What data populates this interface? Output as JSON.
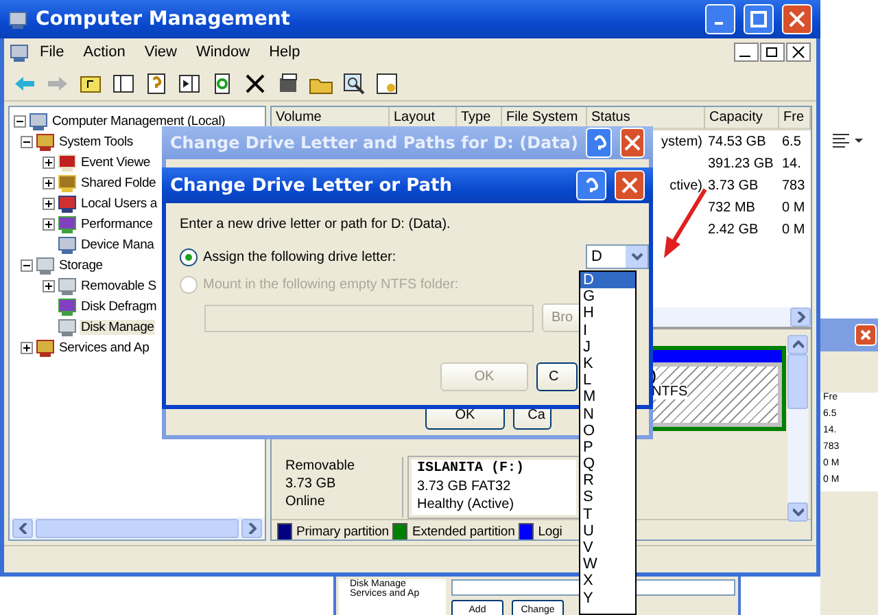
{
  "window": {
    "title": "Computer Management"
  },
  "menu": [
    "File",
    "Action",
    "View",
    "Window",
    "Help"
  ],
  "tree": [
    {
      "label": "Computer Management (Local)",
      "kind": "computer",
      "expanded": true,
      "selected": false,
      "children": [
        {
          "label": "System Tools",
          "kind": "tools",
          "expanded": true,
          "selected": false,
          "children": [
            {
              "label": "Event Viewe",
              "kind": "log",
              "expanded": false,
              "selected": false
            },
            {
              "label": "Shared Folde",
              "kind": "folder",
              "expanded": false,
              "selected": false
            },
            {
              "label": "Local Users a",
              "kind": "users",
              "expanded": false,
              "selected": false
            },
            {
              "label": "Performance",
              "kind": "chart",
              "expanded": false,
              "selected": false
            },
            {
              "label": "Device Mana",
              "kind": "computer",
              "selected": false
            }
          ]
        },
        {
          "label": "Storage",
          "kind": "drive",
          "expanded": true,
          "selected": false,
          "children": [
            {
              "label": "Removable S",
              "kind": "drive",
              "expanded": false,
              "selected": false
            },
            {
              "label": "Disk Defragm",
              "kind": "chart",
              "selected": false
            },
            {
              "label": "Disk Manage",
              "kind": "drive",
              "selected": true
            }
          ]
        },
        {
          "label": "Services and Ap",
          "kind": "tools",
          "expanded": false,
          "selected": false
        }
      ]
    }
  ],
  "volumes": {
    "columns": [
      "Volume",
      "Layout",
      "Type",
      "File System",
      "Status",
      "Capacity",
      "Fre"
    ],
    "rows": [
      {
        "status": "ystem)",
        "capacity": "74.53 GB",
        "free": "6.5"
      },
      {
        "status": "",
        "capacity": "391.23 GB",
        "free": "14."
      },
      {
        "status": "ctive)",
        "capacity": "3.73 GB",
        "free": "783"
      },
      {
        "status": "",
        "capacity": "732 MB",
        "free": "0 M"
      },
      {
        "status": "",
        "capacity": "2.42 GB",
        "free": "0 M"
      }
    ]
  },
  "disk_top": {
    "partition_lines": [
      ")",
      "NTFS"
    ]
  },
  "disk_bottom": {
    "info": [
      "Removable",
      "3.73 GB",
      "Online"
    ],
    "partition_name": "ISLANITA (F:)",
    "partition_lines": [
      "3.73 GB FAT32",
      "Healthy (Active)"
    ]
  },
  "legend": [
    {
      "label": "Primary partition",
      "color": "#000080"
    },
    {
      "label": "Extended partition",
      "color": "#008000"
    },
    {
      "label": "Logi",
      "color": "#0000ff"
    }
  ],
  "outer_dialog": {
    "title": "Change Drive Letter and Paths for D: (Data)",
    "active": false,
    "buttons": [
      {
        "label": "OK",
        "disabled": false
      },
      {
        "label": "Ca",
        "disabled": false
      }
    ]
  },
  "inner_dialog": {
    "title": "Change Drive Letter or Path",
    "active": true,
    "prompt": "Enter a new drive letter or path for D: (Data).",
    "options": [
      {
        "label": "Assign the following drive letter:",
        "selected": true,
        "disabled": false
      },
      {
        "label": "Mount in the following empty NTFS folder:",
        "selected": false,
        "disabled": true
      }
    ],
    "browse": "Bro",
    "buttons": [
      {
        "label": "OK",
        "disabled": true
      },
      {
        "label": "C",
        "disabled": false
      }
    ],
    "drive_value": "D",
    "drive_list": [
      {
        "label": "D",
        "selected": true
      },
      {
        "label": "G",
        "selected": false
      },
      {
        "label": "H",
        "selected": false
      },
      {
        "label": "I",
        "selected": false
      },
      {
        "label": "J",
        "selected": false
      },
      {
        "label": "K",
        "selected": false
      },
      {
        "label": "L",
        "selected": false
      },
      {
        "label": "M",
        "selected": false
      },
      {
        "label": "N",
        "selected": false
      },
      {
        "label": "O",
        "selected": false
      },
      {
        "label": "P",
        "selected": false
      },
      {
        "label": "Q",
        "selected": false
      },
      {
        "label": "R",
        "selected": false
      },
      {
        "label": "S",
        "selected": false
      },
      {
        "label": "T",
        "selected": false
      },
      {
        "label": "U",
        "selected": false
      },
      {
        "label": "V",
        "selected": false
      },
      {
        "label": "W",
        "selected": false
      },
      {
        "label": "X",
        "selected": false
      },
      {
        "label": "Y",
        "selected": false
      }
    ]
  },
  "back_window": {
    "tree": [
      "Disk Manage",
      "Services and Ap"
    ],
    "buttons": [
      "Add",
      "Change"
    ]
  },
  "side_window": {
    "free": [
      "Fre",
      "6.5",
      "14.",
      "783",
      "0 M",
      "0 M"
    ]
  }
}
